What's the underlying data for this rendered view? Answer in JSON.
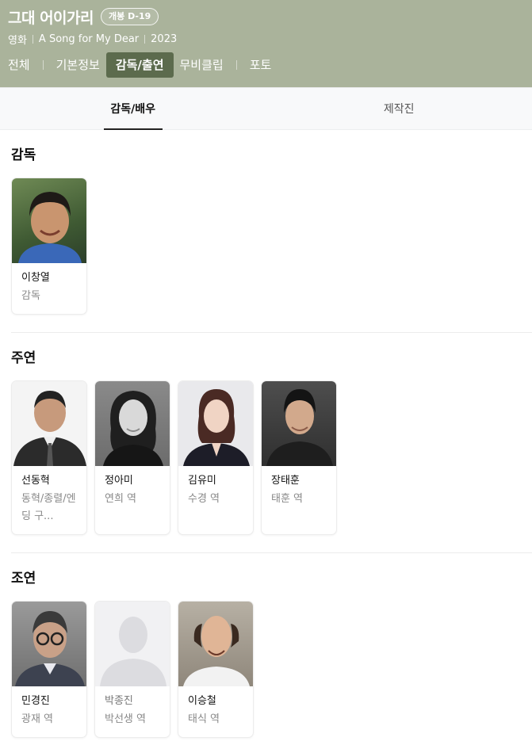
{
  "movie": {
    "title": "그대 어이가리",
    "badge": "개봉 D-19",
    "meta": [
      "영화",
      "A Song for My Dear",
      "2023"
    ]
  },
  "tabs": [
    {
      "label": "전체"
    },
    {
      "label": "기본정보"
    },
    {
      "label": "감독/출연",
      "active": true
    },
    {
      "label": "무비클립"
    },
    {
      "label": "포토"
    }
  ],
  "subtabs": [
    {
      "label": "감독/배우",
      "active": true
    },
    {
      "label": "제작진"
    }
  ],
  "sections": {
    "director": {
      "title": "감독",
      "people": [
        {
          "name": "이창열",
          "role": "감독"
        }
      ]
    },
    "main": {
      "title": "주연",
      "people": [
        {
          "name": "선동혁",
          "role": "동혁/종렬/엔딩 구..."
        },
        {
          "name": "정아미",
          "role": "연희 역"
        },
        {
          "name": "김유미",
          "role": "수경 역"
        },
        {
          "name": "장태훈",
          "role": "태훈 역"
        }
      ]
    },
    "supporting": {
      "title": "조연",
      "people": [
        {
          "name": "민경진",
          "role": "광재 역"
        },
        {
          "name": "박종진",
          "role": "박선생 역"
        },
        {
          "name": "이승철",
          "role": "태식 역"
        }
      ]
    }
  }
}
